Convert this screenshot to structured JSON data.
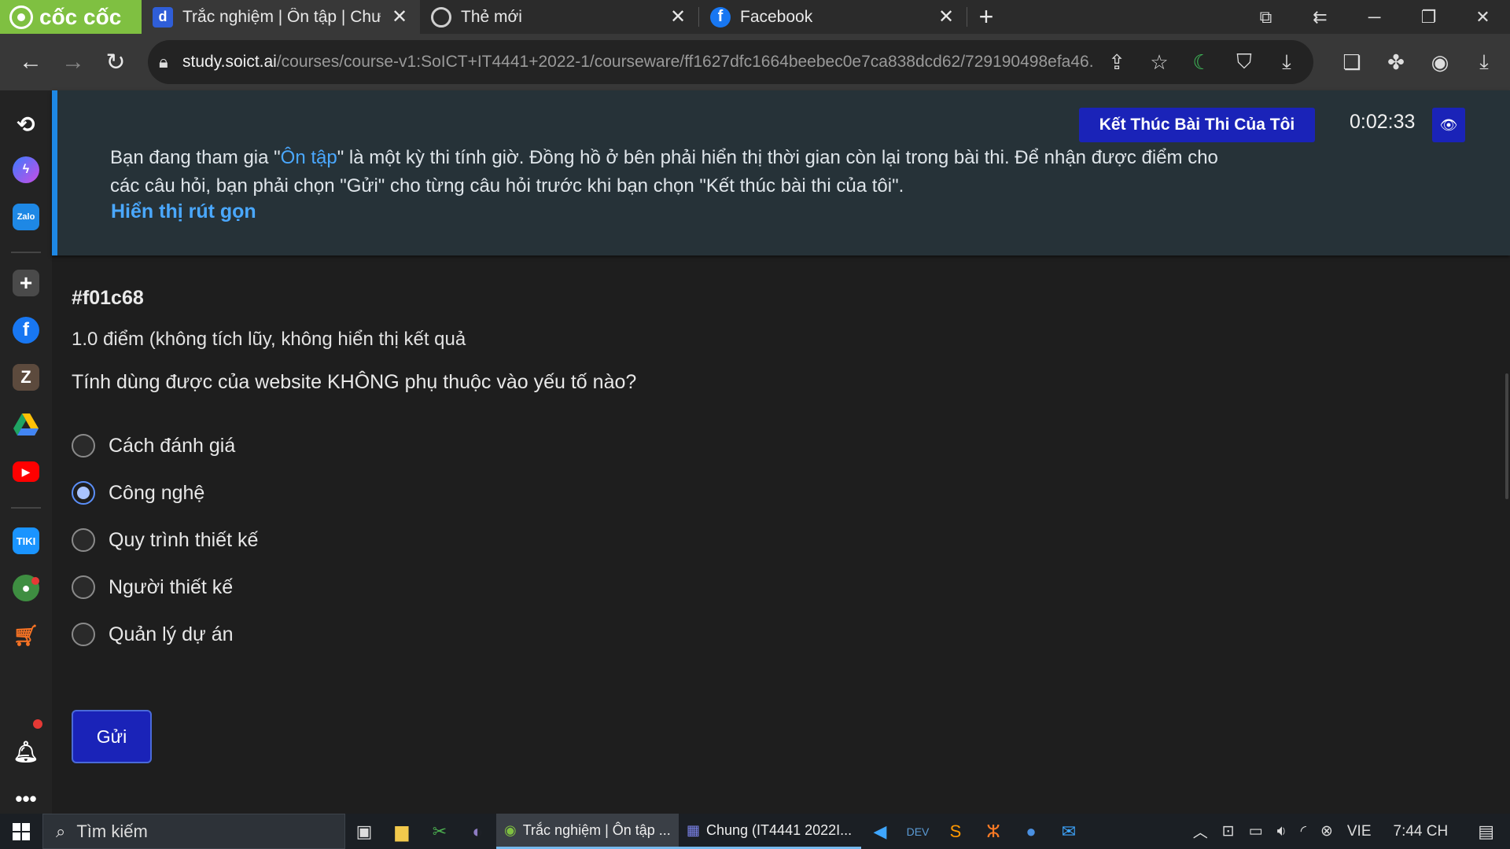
{
  "browser": {
    "brand": "cốc cốc",
    "tabs": [
      {
        "title": "Trắc nghiệm | Ôn tập | Chương",
        "favicon": "d-favicon",
        "active": true
      },
      {
        "title": "Thẻ mới",
        "favicon": "coccoc-favicon",
        "active": false
      },
      {
        "title": "Facebook",
        "favicon": "facebook-favicon",
        "active": false
      }
    ],
    "url_host": "study.soict.ai",
    "url_path": "/courses/course-v1:SoICT+IT4441+2022-1/courseware/ff1627dfc1664beebec0e7ca838dcd62/729190498efa46..."
  },
  "exam": {
    "notice_prefix": "Bạn đang tham gia \"",
    "notice_link": "Ôn tập",
    "notice_suffix": "\" là một kỳ thi tính giờ. Đồng hồ ở bên phải hiển thị thời gian còn lại trong bài thi. Để nhận được điểm cho các câu hỏi, bạn phải chọn \"Gửi\" cho từng câu hỏi trước khi bạn chọn \"Kết thúc bài thi của tôi\".",
    "collapse_label": "Hiển thị rút gọn",
    "end_button": "Kết Thúc Bài Thi Của Tôi",
    "timer": "0:02:33"
  },
  "question": {
    "id": "#f01c68",
    "points": "1.0 điểm (không tích lũy, không hiển thị kết quả",
    "text": "Tính dùng được của website KHÔNG phụ thuộc vào yếu tố nào?",
    "options": [
      "Cách đánh giá",
      "Công nghệ",
      "Quy trình thiết kế",
      "Người thiết kế",
      "Quản lý dự án"
    ],
    "selected_index": 1,
    "submit_label": "Gửi"
  },
  "taskbar": {
    "search_placeholder": "Tìm kiếm",
    "apps": [
      "Trắc nghiệm | Ôn tập ...",
      "Chung (IT4441 2022I..."
    ],
    "language": "VIE",
    "time": "7:44 CH"
  }
}
